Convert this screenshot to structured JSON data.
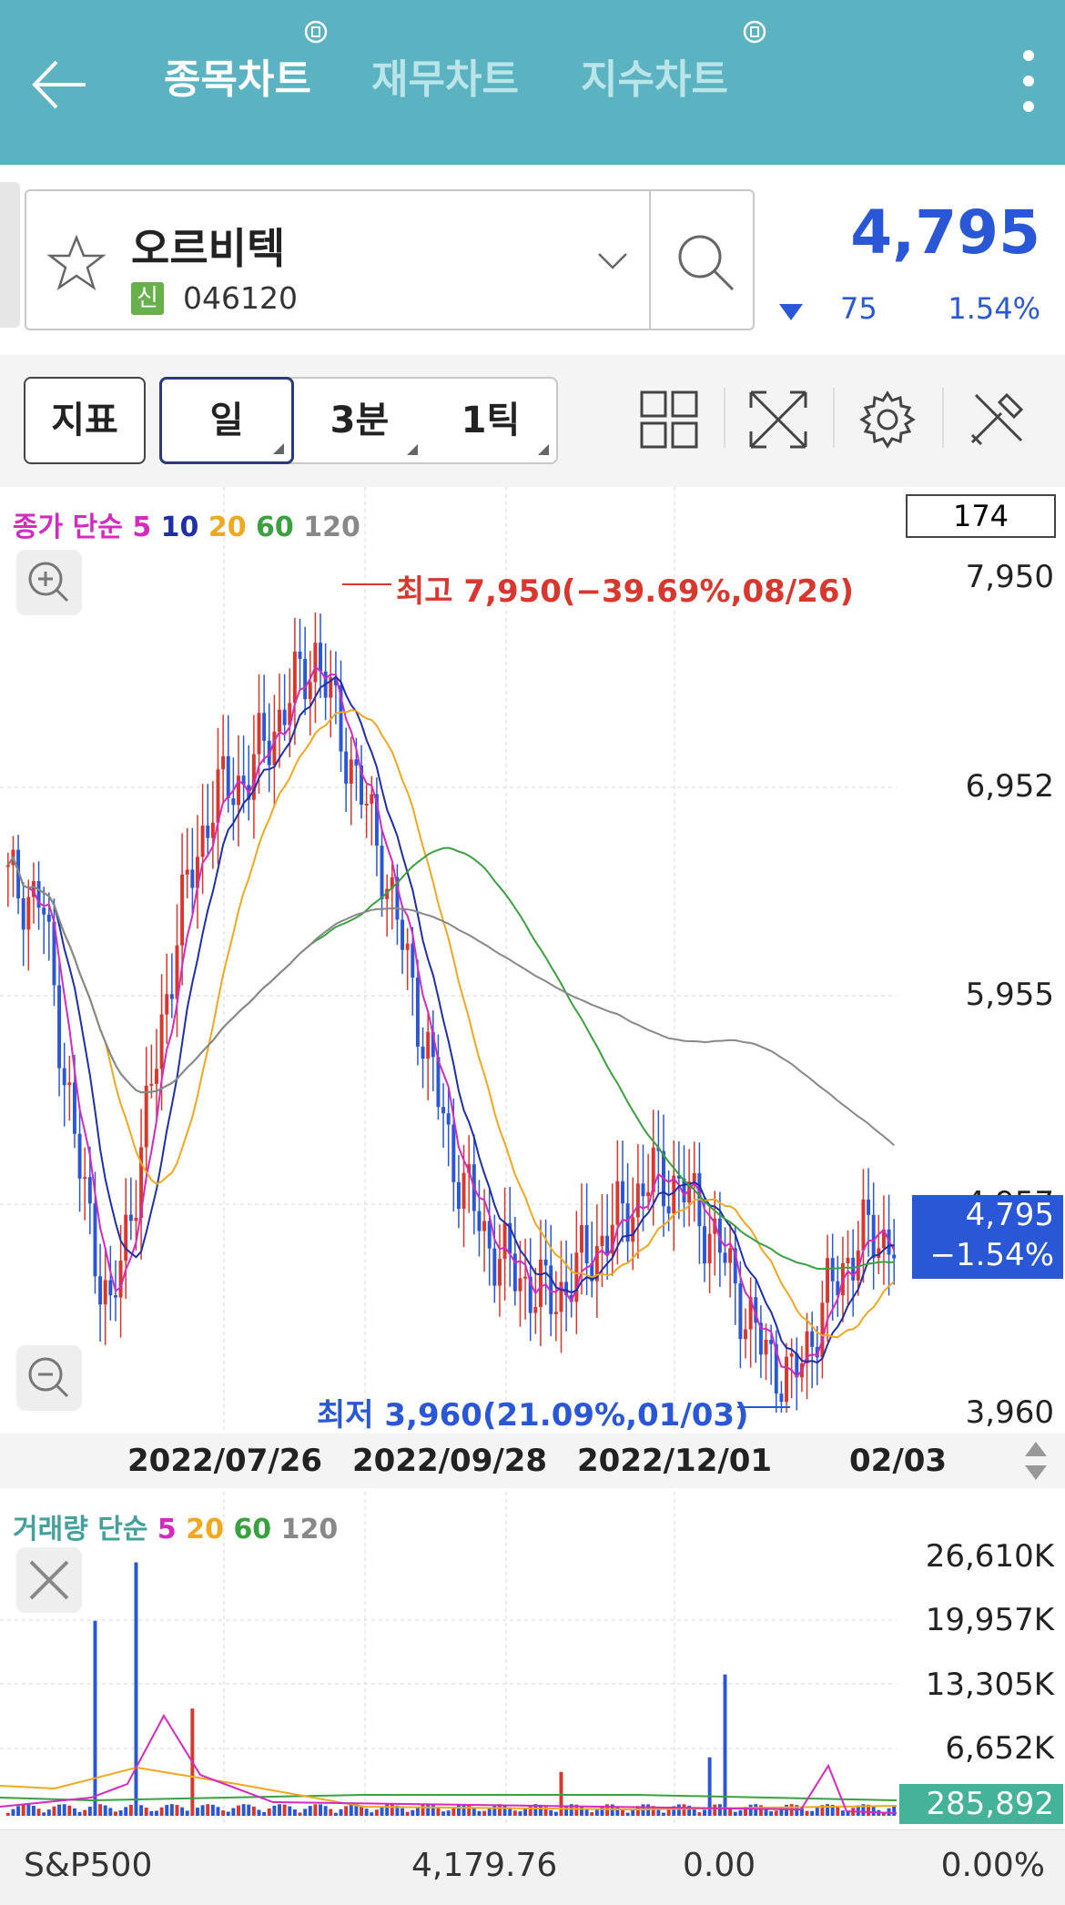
{
  "header": {
    "tabs": [
      {
        "label": "종목차트",
        "active": true
      },
      {
        "label": "재무차트",
        "active": false
      },
      {
        "label": "지수차트",
        "active": false
      }
    ]
  },
  "stock": {
    "name": "오르비텍",
    "badge": "신",
    "code": "046120",
    "price": "4,795",
    "change": "75",
    "change_pct": "1.54%"
  },
  "toolbar": {
    "indicator_label": "지표",
    "periods": [
      "일",
      "3분",
      "1틱"
    ],
    "selected_period": "일"
  },
  "price_chart": {
    "legend_prefix": "종가 단순",
    "legend_periods": [
      "5",
      "10",
      "20",
      "60",
      "120"
    ],
    "legend_colors": [
      "#d22bbd",
      "#1f2fa8",
      "#f0a820",
      "#3aa040",
      "#888888"
    ],
    "count": "174",
    "y_labels": [
      "7,950",
      "6,952",
      "5,955",
      "4,957",
      "3,960"
    ],
    "high_annotation": "최고 7,950(−39.69%,08/26)",
    "low_annotation": "최저 3,960(21.09%,01/03)",
    "current_price": "4,795",
    "current_change": "−1.54%",
    "x_labels": [
      "2022/07/26",
      "2022/09/28",
      "2022/12/01",
      "02/03"
    ]
  },
  "volume_chart": {
    "legend_prefix": "거래량 단순",
    "legend_periods": [
      "5",
      "20",
      "60",
      "120"
    ],
    "legend_colors": [
      "#d22bbd",
      "#f0a820",
      "#3aa040",
      "#888888"
    ],
    "y_labels": [
      "26,610K",
      "19,957K",
      "13,305K",
      "6,652K"
    ],
    "current_volume": "285,892"
  },
  "footer": {
    "index_name": "S&P500",
    "index_value": "4,179.76",
    "index_change": "0.00",
    "index_change_pct": "0.00%"
  },
  "chart_data": [
    {
      "type": "candlestick",
      "title": "",
      "x_labels": [
        "2022/07/26",
        "2022/09/28",
        "2022/12/01",
        "02/03"
      ],
      "ylim": [
        3960,
        7950
      ],
      "close_approx": [
        6500,
        6400,
        5200,
        4400,
        5300,
        6300,
        6900,
        7000,
        7300,
        7600,
        7100,
        6600,
        5900,
        5200,
        4800,
        4600,
        4500,
        4700,
        4900,
        5100,
        5000,
        4700,
        4300,
        4100,
        4500,
        4800,
        4795
      ],
      "series": [
        {
          "name": "5",
          "color": "#d22bbd"
        },
        {
          "name": "10",
          "color": "#1f2fa8"
        },
        {
          "name": "20",
          "color": "#f0a820"
        },
        {
          "name": "60",
          "color": "#3aa040"
        },
        {
          "name": "120",
          "color": "#888888"
        }
      ]
    },
    {
      "type": "bar",
      "title": "",
      "ylim": [
        0,
        26610
      ],
      "note_units": "K",
      "last_value": 285892
    }
  ]
}
